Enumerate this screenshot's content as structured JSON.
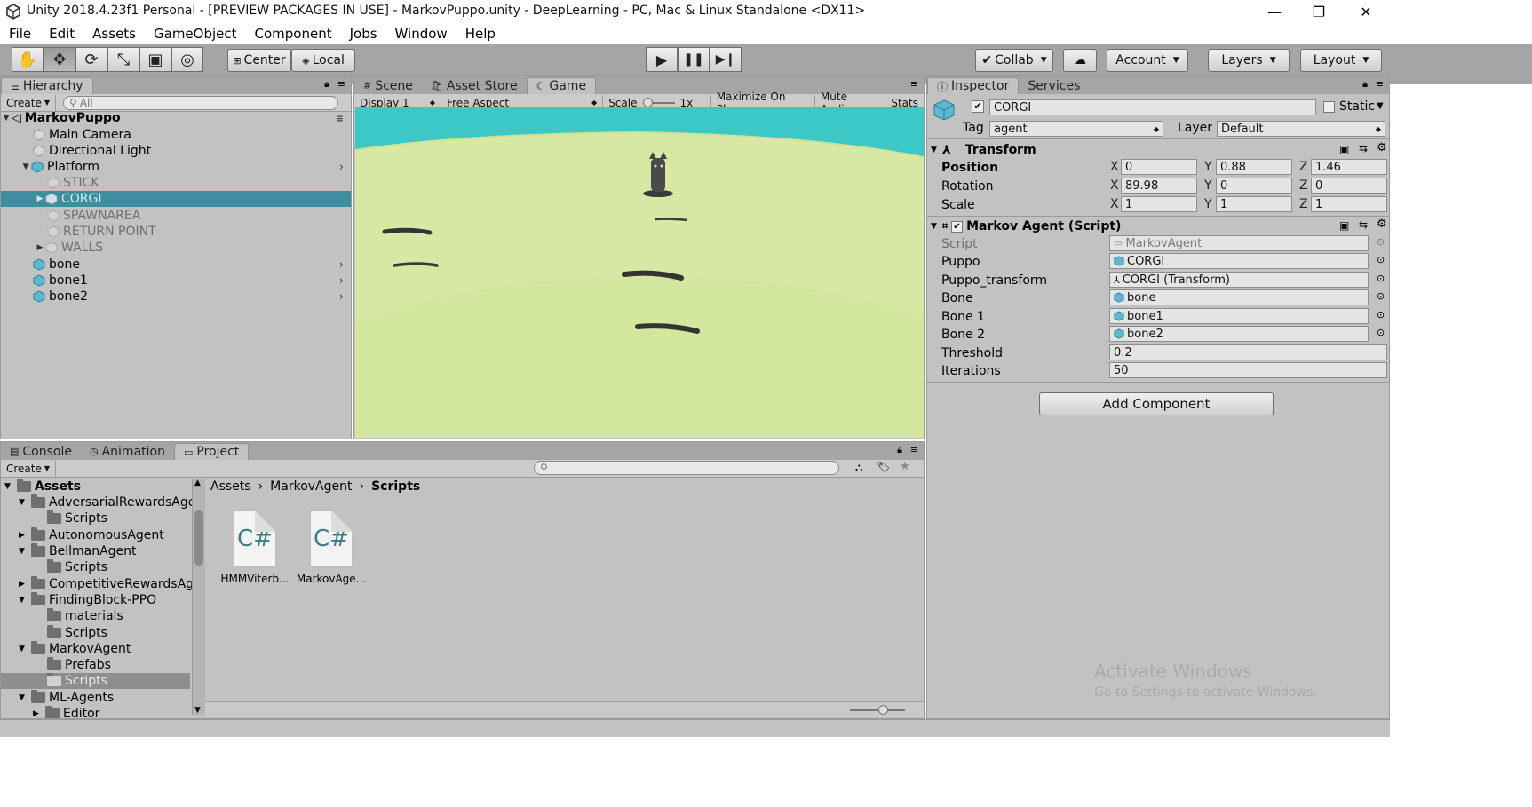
{
  "window": {
    "title": "Unity 2018.4.23f1 Personal - [PREVIEW PACKAGES IN USE] - MarkovPuppo.unity - DeepLearning - PC, Mac & Linux Standalone <DX11>",
    "minimize": "—",
    "maximize": "❐",
    "close": "✕"
  },
  "menu": [
    "File",
    "Edit",
    "Assets",
    "GameObject",
    "Component",
    "Jobs",
    "Window",
    "Help"
  ],
  "toolbar": {
    "tools": [
      "hand-icon",
      "move-icon",
      "rotate-icon",
      "scale-icon",
      "rect-icon",
      "transform-icon"
    ],
    "pivot": "Center",
    "space": "Local",
    "collab": "Collab",
    "account": "Account",
    "layers": "Layers",
    "layout": "Layout"
  },
  "hierarchy": {
    "tab": "Hierarchy",
    "create": "Create",
    "search_placeholder": "All",
    "scene": "MarkovPuppo",
    "items": [
      {
        "label": "Main Camera",
        "depth": 1
      },
      {
        "label": "Directional Light",
        "depth": 1
      },
      {
        "label": "Platform",
        "depth": 1
      },
      {
        "label": "STICK",
        "depth": 2
      },
      {
        "label": "CORGI",
        "depth": 2
      },
      {
        "label": "SPAWNAREA",
        "depth": 2
      },
      {
        "label": "RETURN POINT",
        "depth": 2
      },
      {
        "label": "WALLS",
        "depth": 2
      },
      {
        "label": "bone",
        "depth": 1
      },
      {
        "label": "bone1",
        "depth": 1
      },
      {
        "label": "bone2",
        "depth": 1
      }
    ]
  },
  "scene_tabs": {
    "scene": "Scene",
    "asset_store": "Asset Store",
    "game": "Game",
    "display": "Display 1",
    "aspect": "Free Aspect",
    "scale_label": "Scale",
    "scale_value": "1x",
    "maximize": "Maximize On Play",
    "mute": "Mute Audio",
    "stats": "Stats"
  },
  "inspector": {
    "tab": "Inspector",
    "services": "Services",
    "object_name": "CORGI",
    "static": "Static",
    "tag_label": "Tag",
    "tag": "agent",
    "layer_label": "Layer",
    "layer": "Default",
    "transform": {
      "title": "Transform",
      "position_label": "Position",
      "rotation_label": "Rotation",
      "scale_label": "Scale",
      "position": [
        "0",
        "0.88",
        "1.46"
      ],
      "rotation": [
        "89.98",
        "0",
        "0"
      ],
      "scale": [
        "1",
        "1",
        "1"
      ],
      "axes": [
        "X",
        "Y",
        "Z"
      ]
    },
    "script_component": {
      "title": "Markov Agent (Script)",
      "fields": [
        {
          "label": "Script",
          "value": "MarkovAgent"
        },
        {
          "label": "Puppo",
          "value": "CORGI"
        },
        {
          "label": "Puppo_transform",
          "value": "CORGI (Transform)"
        },
        {
          "label": "Bone",
          "value": "bone"
        },
        {
          "label": "Bone 1",
          "value": "bone1"
        },
        {
          "label": "Bone 2",
          "value": "bone2"
        },
        {
          "label": "Threshold",
          "value": "0.2"
        },
        {
          "label": "Iterations",
          "value": "50"
        }
      ]
    },
    "add_component": "Add Component"
  },
  "bottom_tabs": {
    "console": "Console",
    "animation": "Animation",
    "project": "Project",
    "create": "Create"
  },
  "project": {
    "tree": [
      {
        "label": "Assets",
        "depth": 0,
        "bold": true
      },
      {
        "label": "AdversarialRewardsAge",
        "depth": 1
      },
      {
        "label": "Scripts",
        "depth": 2
      },
      {
        "label": "AutonomousAgent",
        "depth": 1
      },
      {
        "label": "BellmanAgent",
        "depth": 1
      },
      {
        "label": "Scripts",
        "depth": 2
      },
      {
        "label": "CompetitiveRewardsAge",
        "depth": 1
      },
      {
        "label": "FindingBlock-PPO",
        "depth": 1
      },
      {
        "label": "materials",
        "depth": 2
      },
      {
        "label": "Scripts",
        "depth": 2
      },
      {
        "label": "MarkovAgent",
        "depth": 1
      },
      {
        "label": "Prefabs",
        "depth": 2
      },
      {
        "label": "Scripts",
        "depth": 2
      },
      {
        "label": "ML-Agents",
        "depth": 1
      },
      {
        "label": "Editor",
        "depth": 2
      }
    ],
    "breadcrumb": [
      "Assets",
      "MarkovAgent",
      "Scripts"
    ],
    "files": [
      {
        "name": "HMMViterb...",
        "glyph": "C#"
      },
      {
        "name": "MarkovAge...",
        "glyph": "C#"
      }
    ]
  },
  "watermark": {
    "line1": "Activate Windows",
    "line2": "Go to Settings to activate Windows."
  },
  "colors": {
    "panel": "#c2c2c2",
    "toolbar": "#a5a5a5",
    "selection": "#3e8ea0",
    "sky": "#3cc8c6",
    "ground": "#d2e5a0"
  }
}
